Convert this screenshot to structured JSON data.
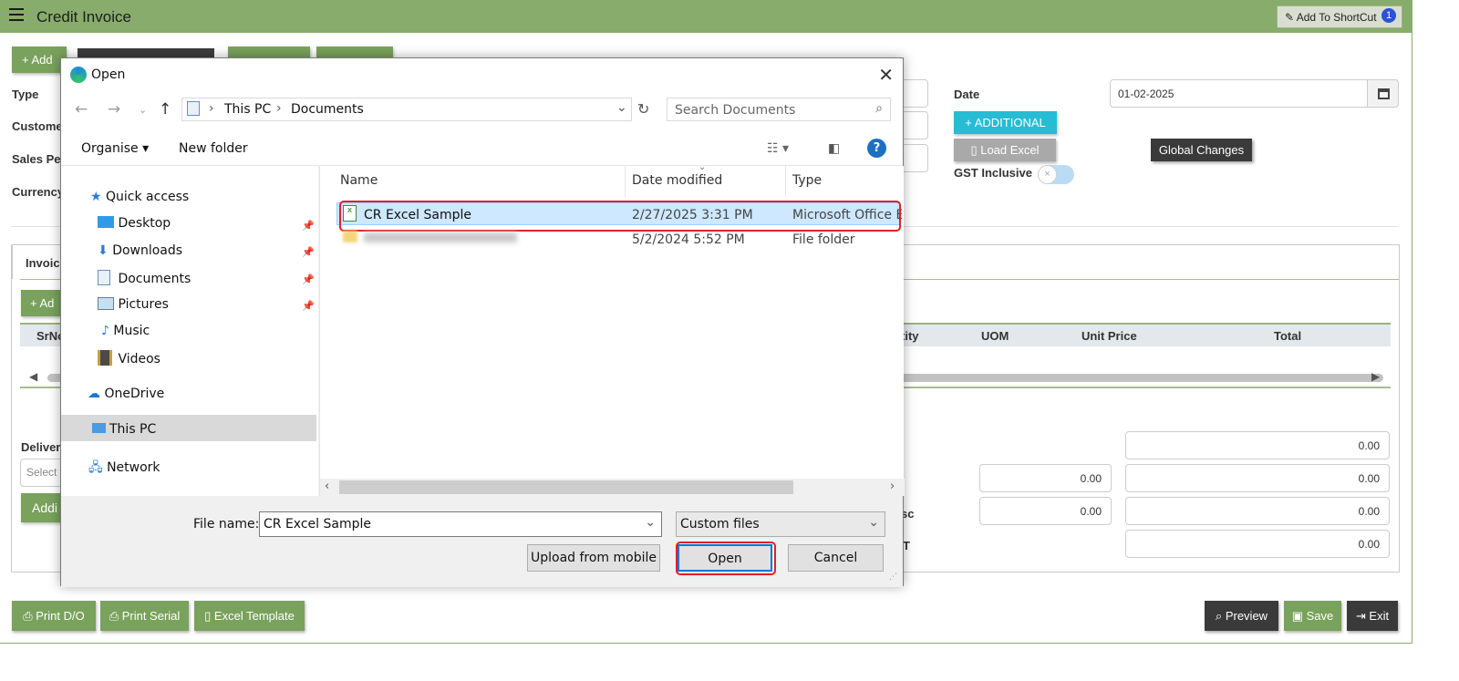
{
  "app": {
    "title": "Credit Invoice",
    "shortcut_label": "Add To ShortCut",
    "shortcut_badge": "1"
  },
  "toolbar": {
    "add_label": "+ Add"
  },
  "form": {
    "type_label": "Type",
    "customer_label": "Customer",
    "sales_person_label": "Sales Pers",
    "currency_label": "Currency",
    "date_label": "Date",
    "date_value": "01-02-2025",
    "additional_label": "+ ADDITIONAL",
    "load_excel_label": "Load Excel",
    "global_changes_label": "Global Changes",
    "gst_inclusive_label": "GST Inclusive"
  },
  "grid": {
    "tab_label": "Invoic",
    "add_label": "+ Ad",
    "columns": [
      "SrNo",
      "tity",
      "UOM",
      "Unit Price",
      "Total"
    ]
  },
  "lower": {
    "delivery_label": "Delivery",
    "select_placeholder": "Select",
    "add_label": "Addi",
    "disc_label": "sc",
    "gst_label": "T",
    "totals": [
      "0.00",
      "0.00",
      "0.00",
      "0.00",
      "0.00",
      "0.00"
    ]
  },
  "bottom_buttons": {
    "print_do": "Print D/O",
    "print_serial": "Print Serial",
    "excel_template": "Excel Template",
    "preview": "Preview",
    "save": "Save",
    "exit": "Exit"
  },
  "dialog": {
    "title": "Open",
    "path": [
      "This PC",
      "Documents"
    ],
    "search_placeholder": "Search Documents",
    "organise": "Organise",
    "new_folder": "New folder",
    "nav": [
      {
        "label": "Quick access",
        "icon": "star-icon"
      },
      {
        "label": "Desktop",
        "icon": "desktop-icon"
      },
      {
        "label": "Downloads",
        "icon": "download-icon"
      },
      {
        "label": "Documents",
        "icon": "document-icon"
      },
      {
        "label": "Pictures",
        "icon": "pictures-icon"
      },
      {
        "label": "Music",
        "icon": "music-icon"
      },
      {
        "label": "Videos",
        "icon": "video-icon"
      },
      {
        "label": "OneDrive",
        "icon": "cloud-icon"
      },
      {
        "label": "This PC",
        "icon": "computer-icon"
      },
      {
        "label": "Network",
        "icon": "network-icon"
      }
    ],
    "columns": {
      "name": "Name",
      "date": "Date modified",
      "type": "Type"
    },
    "files": [
      {
        "name": "CR Excel Sample",
        "date": "2/27/2025 3:31 PM",
        "type": "Microsoft Office E..."
      },
      {
        "name": "",
        "date": "5/2/2024 5:52 PM",
        "type": "File folder"
      }
    ],
    "file_name_label": "File name:",
    "file_name_value": "CR Excel Sample",
    "file_type": "Custom files",
    "upload_label": "Upload from mobile",
    "open_label": "Open",
    "cancel_label": "Cancel"
  },
  "colors": {
    "topbar": "#88ac6c",
    "green_button": "#79a25c",
    "dark_button": "#3a3a3a",
    "additional": "#27bcd4",
    "highlight": "#e0202a"
  }
}
